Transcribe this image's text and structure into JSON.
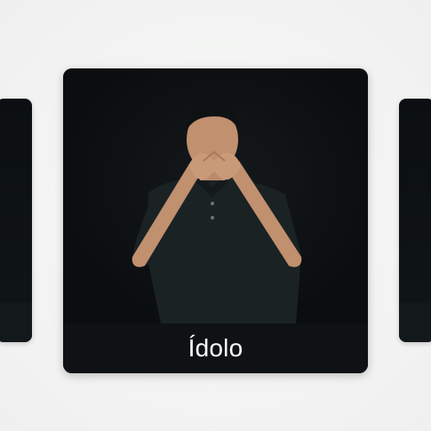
{
  "carousel": {
    "active_card": {
      "caption": "Ídolo",
      "media": "sign-language-video"
    }
  },
  "colors": {
    "background": "#f4f5f4",
    "card": "#0b0f11",
    "caption_text": "#ffffff"
  }
}
